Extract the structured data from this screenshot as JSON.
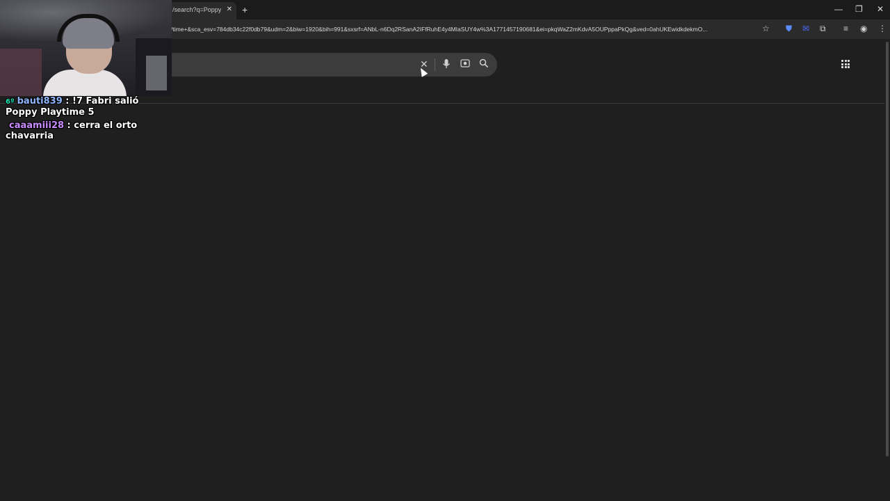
{
  "browser": {
    "tab": {
      "title": "/search?q=Poppy -",
      "close": "✕"
    },
    "new_tab": "+",
    "window_controls": {
      "minimize": "—",
      "maximize": "❐",
      "close": "✕"
    },
    "url": "/time+&sca_esv=784db34c22f0db79&udm=2&biw=1920&bih=991&sxsrf=ANbL-n6Dq2RSanA2IFfRuhE4y4MIaSUY4w%3A1771457190681&ei=pkqWaZ2mKdvA5OUPppaPkQg&ved=0ahUKEwidkdekmO..."
  },
  "search": {
    "clear_icon": "✕",
    "voice_icon": "microphone-icon",
    "lens_icon": "camera-lens-icon",
    "search_icon": "magnifier-icon"
  },
  "chat": {
    "messages": [
      {
        "badge": "6º",
        "user": "bauti839",
        "sep": " : ",
        "text": "!7 Fabri salió Poppy Playtime 5"
      },
      {
        "badge": "",
        "user": "caaamiii28",
        "sep": " : ",
        "text": "cerra el orto chavarria"
      }
    ]
  },
  "colors": {
    "page_bg": "#1f1f1f",
    "search_bg": "#3c3c3c",
    "user1": "#8fb4ff",
    "user2": "#c98cff"
  }
}
